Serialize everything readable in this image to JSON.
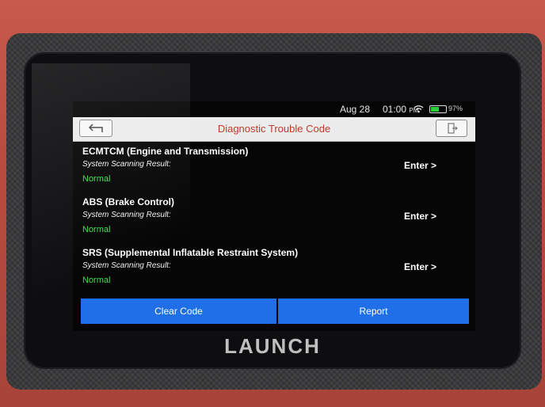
{
  "statusbar": {
    "date": "Aug 28",
    "time": "01:00",
    "ampm": "PM",
    "battery_percent": "97%",
    "battery_color": "#2bcf3a"
  },
  "header": {
    "title": "Diagnostic Trouble Code",
    "back_icon": "back-arrow-icon",
    "exit_icon": "exit-icon",
    "title_color": "#c0392b"
  },
  "systems": [
    {
      "name": "ECMTCM (Engine and Transmission)",
      "label": "System Scanning Result:",
      "status": "Normal",
      "action": "Enter >"
    },
    {
      "name": "ABS (Brake Control)",
      "label": "System Scanning Result:",
      "status": "Normal",
      "action": "Enter >"
    },
    {
      "name": "SRS (Supplemental Inflatable Restraint System)",
      "label": "System Scanning Result:",
      "status": "Normal",
      "action": "Enter >"
    }
  ],
  "buttons": {
    "clear_code": "Clear Code",
    "report": "Report",
    "accent": "#1f6fe8"
  },
  "status_color": "#39e24a",
  "brand": "LAUNCH"
}
